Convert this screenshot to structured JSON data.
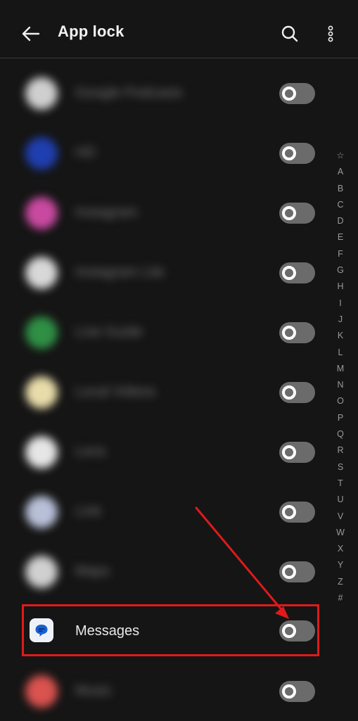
{
  "header": {
    "title": "App lock",
    "icons": [
      "back-arrow-icon",
      "search-icon",
      "more-vertical-icon"
    ]
  },
  "apps": [
    {
      "label": "Google Podcasts",
      "icon_color": "#cfcfcf",
      "blurred": true,
      "locked": false
    },
    {
      "label": "HD",
      "icon_color": "#1f3fb0",
      "blurred": true,
      "locked": false
    },
    {
      "label": "Instagram",
      "icon_color": "#c84aa0",
      "blurred": true,
      "locked": false
    },
    {
      "label": "Instagram Lite",
      "icon_color": "#d8d8d8",
      "blurred": true,
      "locked": false
    },
    {
      "label": "Live Guide",
      "icon_color": "#2f8f45",
      "blurred": true,
      "locked": false
    },
    {
      "label": "Local Videos",
      "icon_color": "#e8dcaa",
      "blurred": true,
      "locked": false
    },
    {
      "label": "Lens",
      "icon_color": "#e6e6e6",
      "blurred": true,
      "locked": false
    },
    {
      "label": "Link",
      "icon_color": "#b8c0d8",
      "blurred": true,
      "locked": false
    },
    {
      "label": "Maps",
      "icon_color": "#d0d0d0",
      "blurred": true,
      "locked": false
    },
    {
      "label": "Messages",
      "icon_color": "#eef2f8",
      "blurred": false,
      "locked": false
    },
    {
      "label": "Music",
      "icon_color": "#d9534f",
      "blurred": true,
      "locked": false
    }
  ],
  "alphabet": [
    "☆",
    "A",
    "B",
    "C",
    "D",
    "E",
    "F",
    "G",
    "H",
    "I",
    "J",
    "K",
    "L",
    "M",
    "N",
    "O",
    "P",
    "Q",
    "R",
    "S",
    "T",
    "U",
    "V",
    "W",
    "X",
    "Y",
    "Z",
    "#"
  ],
  "annotation": {
    "color": "#e01a1a"
  }
}
